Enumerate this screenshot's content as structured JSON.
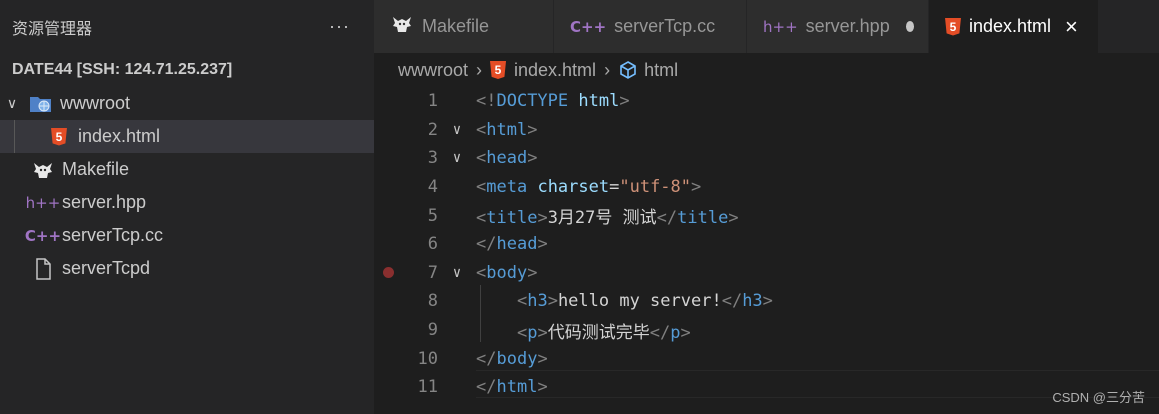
{
  "sidebar": {
    "title": "资源管理器",
    "more": "···",
    "section": "DATE44 [SSH: 124.71.25.237]",
    "tree": [
      {
        "label": "wwwroot",
        "icon": "folder-web-icon",
        "chevron": "∨"
      },
      {
        "label": "index.html",
        "icon": "html5-icon",
        "glyph": "5"
      },
      {
        "label": "Makefile",
        "icon": "gnu-icon"
      },
      {
        "label": "server.hpp",
        "icon": "hpp-icon",
        "glyph": "h++"
      },
      {
        "label": "serverTcp.cc",
        "icon": "cpp-icon",
        "glyph": "C++"
      },
      {
        "label": "serverTcpd",
        "icon": "file-icon"
      }
    ]
  },
  "tabs": [
    {
      "label": "Makefile",
      "icon": "gnu-icon"
    },
    {
      "label": "serverTcp.cc",
      "icon": "cpp-icon",
      "glyph": "C++"
    },
    {
      "label": "server.hpp",
      "icon": "hpp-icon",
      "glyph": "h++",
      "modified": true
    },
    {
      "label": "index.html",
      "icon": "html5-icon",
      "glyph": "5",
      "active": true,
      "close": "×"
    }
  ],
  "breadcrumb": {
    "folder": "wwwroot",
    "file": "index.html",
    "symbol": "html",
    "sep": "›"
  },
  "editor": {
    "lines": [
      {
        "n": "1",
        "fold": "",
        "indent": "",
        "tokens": [
          [
            "t-punc",
            "<!"
          ],
          [
            "t-tag",
            "DOCTYPE"
          ],
          [
            "t-txt",
            " "
          ],
          [
            "t-attr",
            "html"
          ],
          [
            "t-punc",
            ">"
          ]
        ]
      },
      {
        "n": "2",
        "fold": "∨",
        "indent": "",
        "tokens": [
          [
            "t-punc",
            "<"
          ],
          [
            "t-tag",
            "html"
          ],
          [
            "t-punc",
            ">"
          ]
        ]
      },
      {
        "n": "3",
        "fold": "∨",
        "indent": "",
        "tokens": [
          [
            "t-punc",
            "<"
          ],
          [
            "t-tag",
            "head"
          ],
          [
            "t-punc",
            ">"
          ]
        ]
      },
      {
        "n": "4",
        "fold": "",
        "indent": "",
        "tokens": [
          [
            "t-punc",
            "<"
          ],
          [
            "t-tag",
            "meta"
          ],
          [
            "t-txt",
            " "
          ],
          [
            "t-attr",
            "charset"
          ],
          [
            "t-txt",
            "="
          ],
          [
            "t-str",
            "\"utf-8\""
          ],
          [
            "t-punc",
            ">"
          ]
        ]
      },
      {
        "n": "5",
        "fold": "",
        "indent": "",
        "tokens": [
          [
            "t-punc",
            "<"
          ],
          [
            "t-tag",
            "title"
          ],
          [
            "t-punc",
            ">"
          ],
          [
            "t-txt",
            "3月27号 测试"
          ],
          [
            "t-punc",
            "</"
          ],
          [
            "t-tag",
            "title"
          ],
          [
            "t-punc",
            ">"
          ]
        ]
      },
      {
        "n": "6",
        "fold": "",
        "indent": "",
        "tokens": [
          [
            "t-punc",
            "</"
          ],
          [
            "t-tag",
            "head"
          ],
          [
            "t-punc",
            ">"
          ]
        ]
      },
      {
        "n": "7",
        "fold": "∨",
        "indent": "",
        "breakpoint": true,
        "tokens": [
          [
            "t-punc",
            "<"
          ],
          [
            "t-tag",
            "body"
          ],
          [
            "t-punc",
            ">"
          ]
        ]
      },
      {
        "n": "8",
        "fold": "",
        "indent": "    ",
        "tokens": [
          [
            "t-punc",
            "<"
          ],
          [
            "t-tag",
            "h3"
          ],
          [
            "t-punc",
            ">"
          ],
          [
            "t-txt",
            "hello my server!"
          ],
          [
            "t-punc",
            "</"
          ],
          [
            "t-tag",
            "h3"
          ],
          [
            "t-punc",
            ">"
          ]
        ]
      },
      {
        "n": "9",
        "fold": "",
        "indent": "    ",
        "tokens": [
          [
            "t-punc",
            "<"
          ],
          [
            "t-tag",
            "p"
          ],
          [
            "t-punc",
            ">"
          ],
          [
            "t-txt",
            "代码测试完毕"
          ],
          [
            "t-punc",
            "</"
          ],
          [
            "t-tag",
            "p"
          ],
          [
            "t-punc",
            ">"
          ]
        ]
      },
      {
        "n": "10",
        "fold": "",
        "indent": "",
        "tokens": [
          [
            "t-punc",
            "</"
          ],
          [
            "t-tag",
            "body"
          ],
          [
            "t-punc",
            ">"
          ]
        ]
      },
      {
        "n": "11",
        "fold": "",
        "indent": "",
        "tokens": [
          [
            "t-punc",
            "</"
          ],
          [
            "t-tag",
            "html"
          ],
          [
            "t-punc",
            ">"
          ]
        ]
      }
    ]
  },
  "watermark": "CSDN @三分苦",
  "colors": {
    "html5": "#e44d26",
    "cpp": "#a074c4",
    "breakpoint": "#8a2f2f",
    "tag": "#569cd6",
    "attr": "#9cdcfe",
    "string": "#ce9178"
  }
}
